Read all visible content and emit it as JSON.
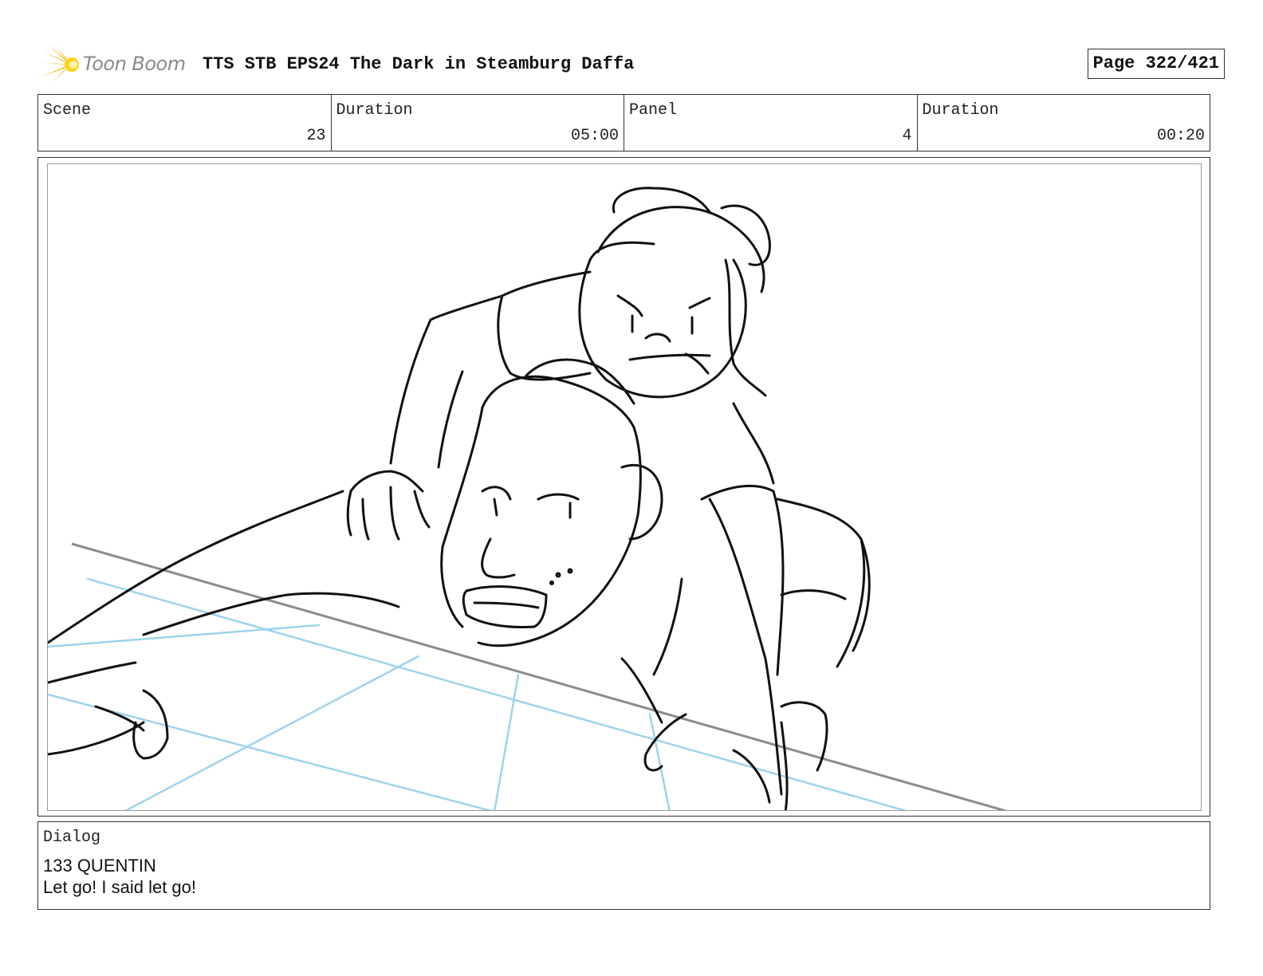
{
  "header": {
    "logo_text": "Toon Boom",
    "title": "TTS STB EPS24 The Dark in Steamburg Daffa",
    "page": "Page 322/421"
  },
  "info": {
    "scene_label": "Scene",
    "scene_value": "23",
    "scene_duration_label": "Duration",
    "scene_duration_value": "05:00",
    "panel_label": "Panel",
    "panel_value": "4",
    "panel_duration_label": "Duration",
    "panel_duration_value": "00:20"
  },
  "dialog": {
    "label": "Dialog",
    "line1": "133 QUENTIN",
    "line2": "Let go! I said let go!"
  },
  "colors": {
    "logo_yellow": "#f5b800",
    "guide_blue": "#9ed3ee",
    "horizon_gray": "#8c8c8c",
    "ink": "#111111"
  }
}
